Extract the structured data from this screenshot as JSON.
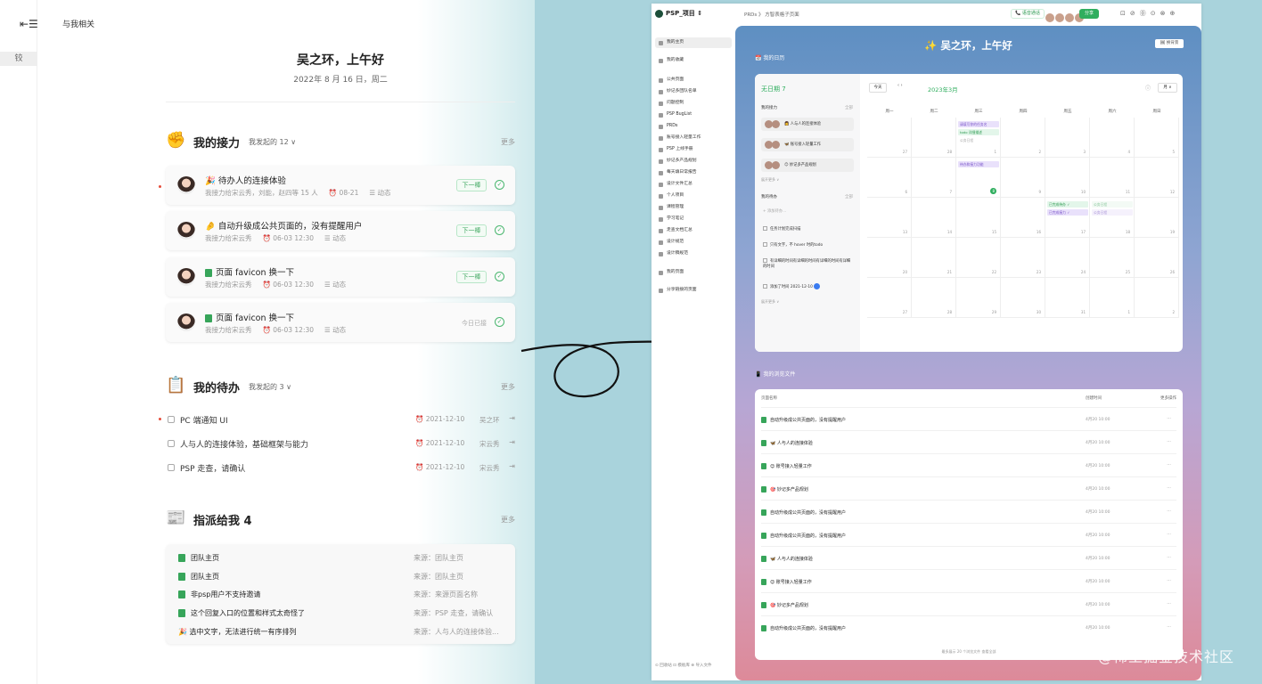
{
  "left": {
    "sidebar_toggle": "⇤☰",
    "sidebar_item": "铰",
    "title": "与我相关",
    "greeting": "吴之环，上午好",
    "date": "2022年 8 月 16 日，周二",
    "relay": {
      "title": "我的接力",
      "filter": "我发起的 12",
      "more": "更多",
      "cards": [
        {
          "title": "🎉 待办人的连接体验",
          "meta": "我接力给宋云秀，刘能，赵四等 15 人",
          "date": "08-21",
          "activity": "动态",
          "action": "下一棒"
        },
        {
          "title": "🤌 自动升级成公共页面的，没有提醒用户",
          "meta": "我接力给宋云秀",
          "date": "06-03 12:30",
          "activity": "动态",
          "action": "下一棒"
        },
        {
          "title": "页面 favicon 换一下",
          "meta": "我接力给宋云秀",
          "date": "06-03 12:30",
          "activity": "动态",
          "action": "下一棒"
        },
        {
          "title": "页面 favicon 换一下",
          "meta": "我接力给宋云秀",
          "date": "06-03 12:30",
          "activity": "动态",
          "action": "今日已接"
        }
      ]
    },
    "todo": {
      "title": "我的待办",
      "filter": "我发起的 3",
      "more": "更多",
      "items": [
        {
          "text": "PC 端通知 UI",
          "date": "2021-12-10",
          "user": "吴之环"
        },
        {
          "text": "人与人的连接体验，基础框架与能力",
          "date": "2021-12-10",
          "user": "宋云秀"
        },
        {
          "text": "PSP 走查，请确认",
          "date": "2021-12-10",
          "user": "宋云秀"
        }
      ]
    },
    "assigned": {
      "title": "指派给我 4",
      "more": "更多",
      "items": [
        {
          "text": "团队主页",
          "source": "来源：团队主页"
        },
        {
          "text": "团队主页",
          "source": "来源：团队主页"
        },
        {
          "text": "非psp用户不支持邀请",
          "source": "来源：来源页面名称"
        },
        {
          "text": "这个回复入口的位置和样式太奇怪了",
          "source": "来源：PSP 走查，请确认"
        },
        {
          "text": "🎉 选中文字，无法进行统一有序排列",
          "source": "来源：人与人的连接体验..."
        }
      ]
    }
  },
  "right": {
    "workspace": "PSP_项目",
    "breadcrumb": "PRDs  》 方智表格子页面",
    "meeting": "语音通话",
    "share": "分享",
    "toolbar_icons": "⊡⊘⓪⊙⊗⊕",
    "nav": [
      "我的主页",
      "我的收藏",
      "公共页面",
      "妙记多团队名单",
      "问题控制",
      "PSP BugList",
      "PRDs",
      "账号接入轻量工作",
      "PSP 上线手册",
      "妙记多产品规划",
      "每天填日常报告",
      "设计文件汇总",
      "个人项目",
      "课程管理",
      "学习笔记",
      "走查文档汇总",
      "设计规范",
      "设计稿规范",
      "我的页面",
      "分享链接的页面"
    ],
    "footer": "⊙ 回收站   ⊡ 模板库   ⊕ 导入文件",
    "greeting": "✨ 吴之环，上午好",
    "edit_button": "🖼 换背景",
    "calendar_title": "我的日历",
    "files_title": "我的浏览文件",
    "calendar": {
      "no_date": "无日期 7",
      "relay": "我的接力",
      "relay_more": "全部",
      "relay_items": [
        "👩 人与人的连接体验",
        "🦋 账号接入轻量工作",
        "😊 妙记多产品规划"
      ],
      "relay_all": "展开更多 ∨",
      "todo": "我的待办",
      "todo_more": "全部",
      "new_todo": "+ 添加待办...",
      "todos": [
        "任务计划完成扫描",
        "只有文字，不 hover 时的todo",
        "有详细的时间有详细的时间有详细的时间有详细的时间"
      ],
      "todo_added": "添加了时间  2021-12-10",
      "todo_all": "展开更多 ∨",
      "today": "今天",
      "nav": "‹  ›",
      "month": "2023年3月",
      "info_icon": "ⓘ",
      "view": "月 ∨",
      "weekdays": [
        "周一",
        "周二",
        "周三",
        "周四",
        "周五",
        "周六",
        "周日"
      ],
      "days": [
        "27",
        "28",
        "1",
        "2",
        "3",
        "4",
        "5",
        "6",
        "7",
        "8",
        "9",
        "10",
        "11",
        "12",
        "13",
        "14",
        "15",
        "16",
        "17",
        "18",
        "19",
        "20",
        "21",
        "22",
        "23",
        "24",
        "25",
        "26",
        "27",
        "28",
        "29",
        "30",
        "31",
        "1",
        "2"
      ],
      "events": [
        {
          "label": "请填写你的任务名",
          "col": 2,
          "row": 0,
          "slot": 0,
          "color": "#e9e1fb",
          "text": "#7a55c9"
        },
        {
          "label": "todo 详细描述",
          "col": 2,
          "row": 0,
          "slot": 1,
          "color": "#e3f6ea",
          "text": "#2e9a52"
        },
        {
          "label": "公务日程",
          "col": 2,
          "row": 0,
          "slot": 2,
          "color": "#ffffff",
          "text": "#aaaaaa"
        },
        {
          "label": "待办和接力功能",
          "col": 2,
          "row": 1,
          "slot": 0,
          "color": "#e9e1fb",
          "text": "#7a55c9"
        },
        {
          "label": "已完成待办 ✓",
          "col": 4,
          "row": 2,
          "slot": 0,
          "color": "#e3f6ea",
          "text": "#2e9a52"
        },
        {
          "label": "已完成接力 ✓",
          "col": 4,
          "row": 2,
          "slot": 1,
          "color": "#e9e1fb",
          "text": "#7a55c9"
        },
        {
          "label": "公务日程",
          "col": 5,
          "row": 2,
          "slot": 0,
          "color": "#f3faf5",
          "text": "#8ac79d"
        },
        {
          "label": "公务日程",
          "col": 5,
          "row": 2,
          "slot": 1,
          "color": "#f5f1fc",
          "text": "#a893d6"
        }
      ]
    },
    "files": {
      "col_name": "页面名称",
      "col_time": "创建时间",
      "col_action": "更多操作",
      "rows": [
        {
          "name": "自动升级成公共页面的，没有提醒用户",
          "time": "4月20 10:00"
        },
        {
          "name": "🦋 人与人的连接体验",
          "time": "4月20 10:00"
        },
        {
          "name": "😊 账号接入轻量工作",
          "time": "4月20 10:00"
        },
        {
          "name": "🎯 妙记多产品规划",
          "time": "4月20 10:00"
        },
        {
          "name": "自动升级成公共页面的，没有提醒用户",
          "time": "4月20 10:00"
        },
        {
          "name": "自动升级成公共页面的，没有提醒用户",
          "time": "4月20 10:00"
        },
        {
          "name": "🦋 人与人的连接体验",
          "time": "4月20 10:00"
        },
        {
          "name": "😊 账号接入轻量工作",
          "time": "4月20 10:00"
        },
        {
          "name": "🎯 妙记多产品规划",
          "time": "4月20 10:00"
        },
        {
          "name": "自动升级成公共页面的，没有提醒用户",
          "time": "4月20 10:00"
        }
      ],
      "more": "···",
      "footer": "最多展示 20 个浏览文件  查看全部"
    }
  },
  "watermark": "@稀土掘金技术社区"
}
